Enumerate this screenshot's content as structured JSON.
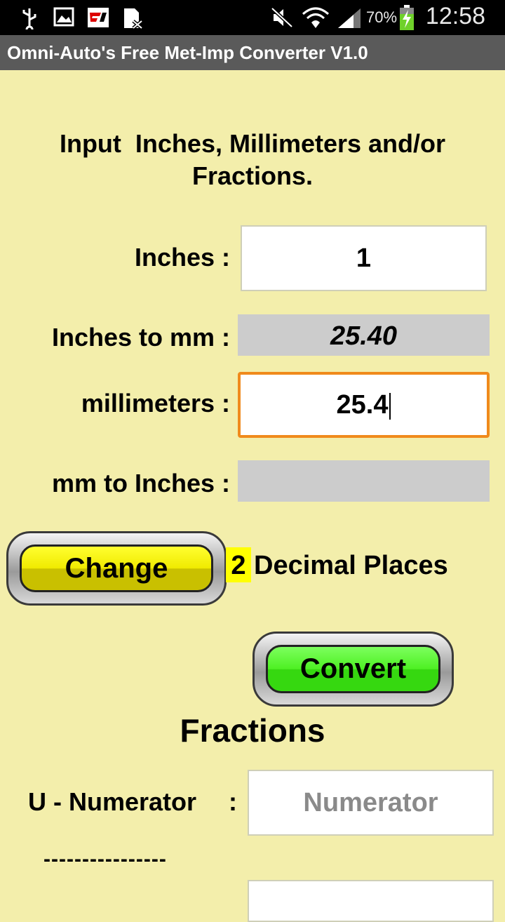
{
  "status_bar": {
    "time": "12:58",
    "battery_percent": "70%",
    "icons": [
      "usb-icon",
      "image-icon",
      "f1-app-icon",
      "sim-icon",
      "mute-icon",
      "wifi-icon",
      "signal-icon",
      "battery-charging-icon"
    ]
  },
  "app": {
    "title": "Omni-Auto's Free Met-Imp Converter V1.0"
  },
  "instructions": {
    "line1": "Input  Inches, Millimeters and/or",
    "line2": "Fractions."
  },
  "inches": {
    "label": "Inches :",
    "value": "1"
  },
  "inches_to_mm": {
    "label": "Inches to mm :",
    "value": "25.40"
  },
  "millimeters": {
    "label": "millimeters :",
    "value": "25.4"
  },
  "mm_to_inches": {
    "label": "mm to Inches :",
    "value": ""
  },
  "decimal": {
    "button_label": "Change",
    "places": "2",
    "label": "Decimal Places"
  },
  "convert": {
    "button_label": "Convert"
  },
  "fractions": {
    "title": "Fractions",
    "numerator_label": "U - Numerator",
    "colon": ":",
    "numerator_placeholder": "Numerator",
    "divider": "----------------"
  },
  "colors": {
    "background": "#f3eeab",
    "change_button": "#f0ea00",
    "convert_button": "#4ef023",
    "focus_border": "#f08a1c"
  }
}
